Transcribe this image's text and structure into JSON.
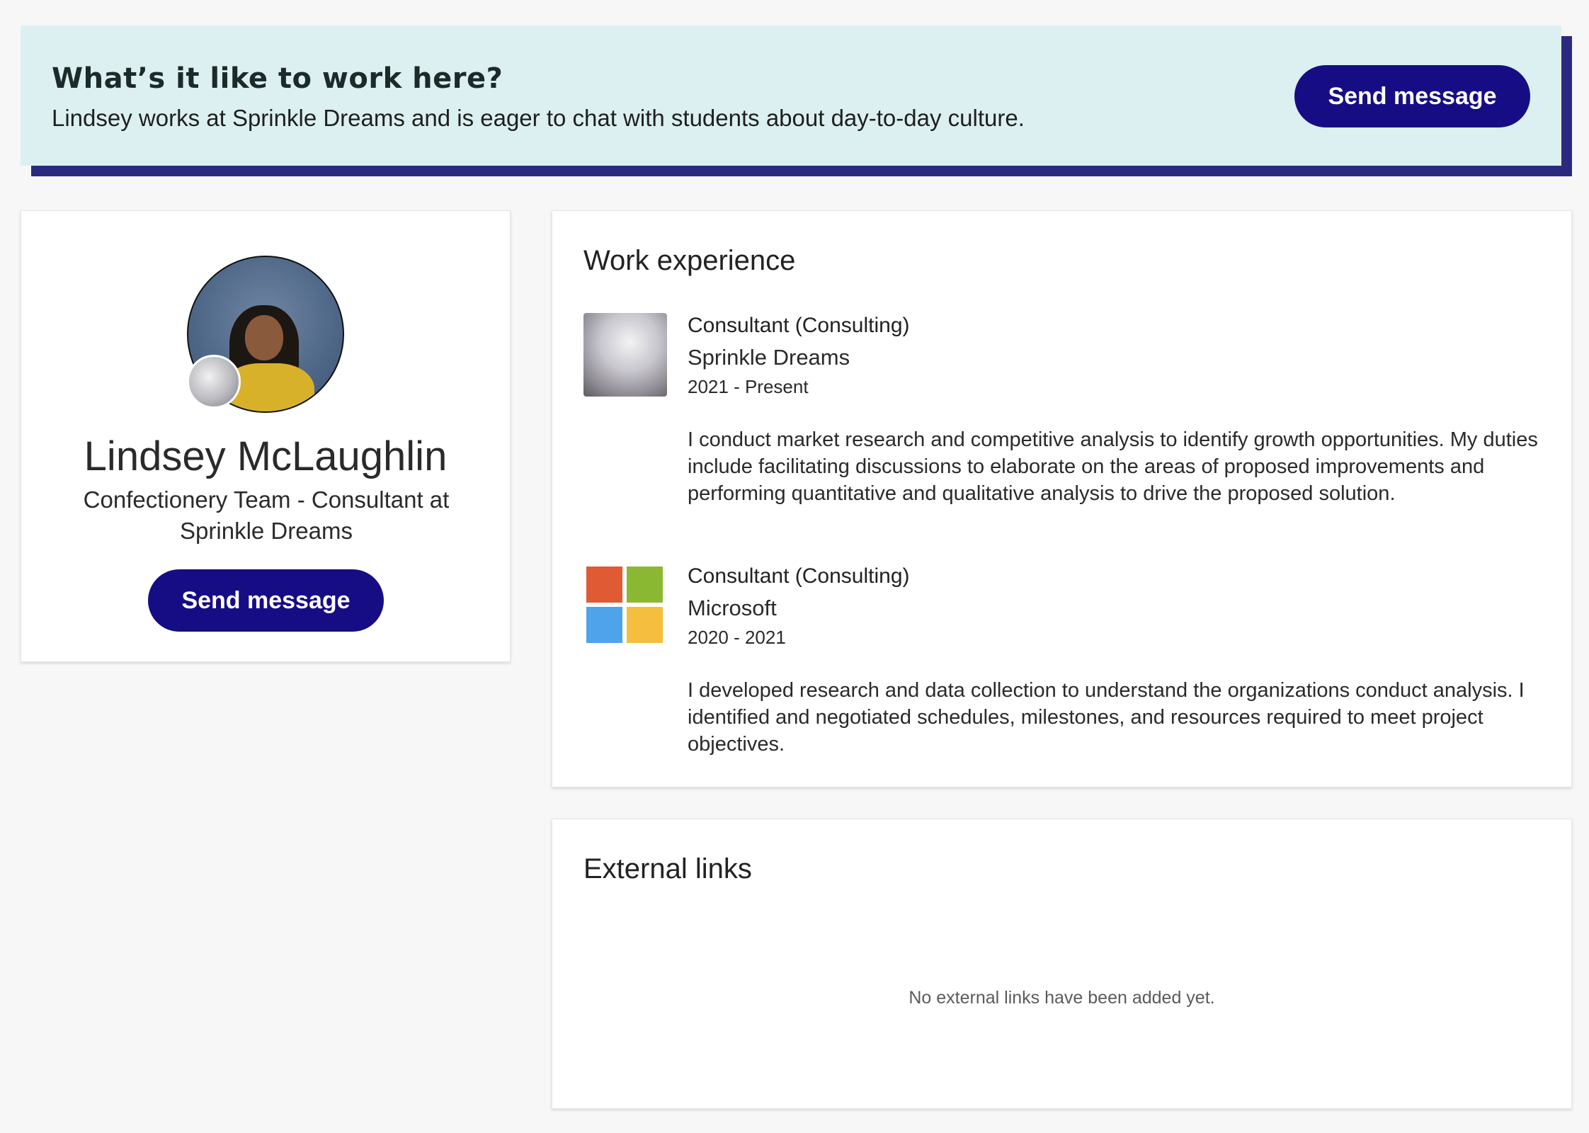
{
  "banner": {
    "title": "What’s it like to work here?",
    "text": "Lindsey works at Sprinkle Dreams and is eager to chat with students about day-to-day culture.",
    "button_label": "Send message"
  },
  "profile": {
    "name": "Lindsey McLaughlin",
    "headline": "Confectionery Team - Consultant at Sprinkle Dreams",
    "button_label": "Send message",
    "avatar_icon": "person-photo",
    "badge_icon": "company-logo-badge"
  },
  "work_experience": {
    "title": "Work experience",
    "jobs": [
      {
        "title": "Consultant (Consulting)",
        "company": "Sprinkle Dreams",
        "dates": "2021 - Present",
        "description": "I conduct market research and competitive analysis to identify growth opportunities. My duties include facilitating discussions to elaborate on the areas of proposed improvements and performing quantitative and qualitative analysis to drive the proposed solution.",
        "logo_icon": "sprinkle-dreams-logo"
      },
      {
        "title": "Consultant (Consulting)",
        "company": "Microsoft",
        "dates": "2020 - 2021",
        "description": "I developed research and data collection to understand the organizations conduct analysis. I identified and negotiated schedules, milestones, and resources required to meet project objectives.",
        "logo_icon": "microsoft-logo"
      }
    ]
  },
  "external_links": {
    "title": "External links",
    "empty_text": "No external links have been added yet."
  },
  "colors": {
    "primary_button": "#160d85",
    "banner_bg": "#dcf0f1",
    "banner_shadow": "#2b2a7e",
    "ms_red": "#e05a33",
    "ms_green": "#8bb832",
    "ms_blue": "#4ea3ea",
    "ms_yellow": "#f4be3e"
  }
}
